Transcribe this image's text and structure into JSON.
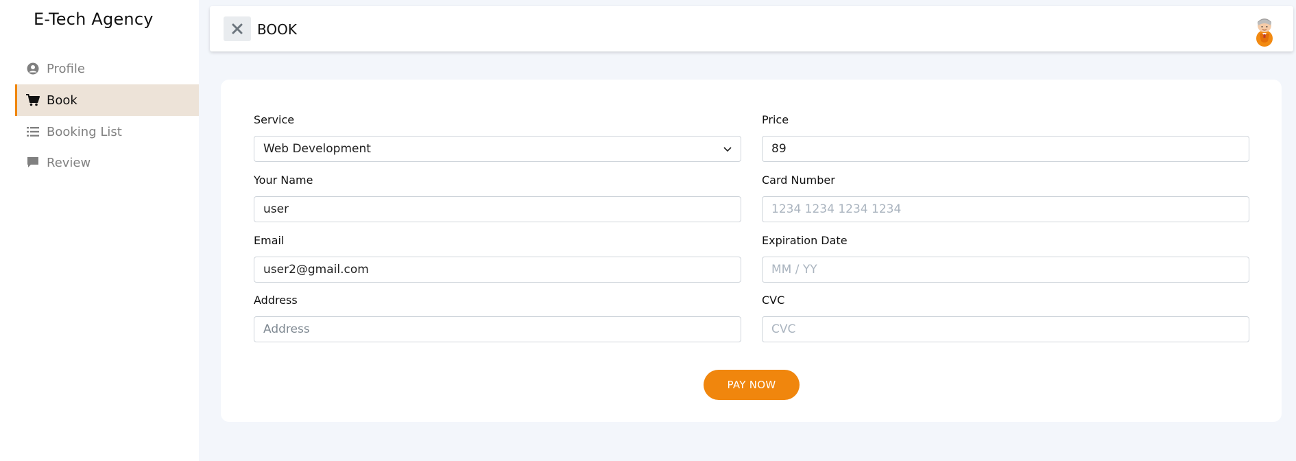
{
  "brand": "E-Tech Agency",
  "sidebar": {
    "items": [
      {
        "label": "Profile",
        "icon": "user-circle-icon"
      },
      {
        "label": "Book",
        "icon": "cart-icon",
        "active": true
      },
      {
        "label": "Booking List",
        "icon": "list-icon"
      },
      {
        "label": "Review",
        "icon": "comment-icon"
      }
    ]
  },
  "header": {
    "title": "BOOK"
  },
  "form": {
    "service": {
      "label": "Service",
      "value": "Web Development"
    },
    "price": {
      "label": "Price",
      "value": "89"
    },
    "name": {
      "label": "Your Name",
      "value": "user"
    },
    "card_number": {
      "label": "Card Number",
      "placeholder": "1234 1234 1234 1234"
    },
    "email": {
      "label": "Email",
      "value": "user2@gmail.com"
    },
    "expiration": {
      "label": "Expiration Date",
      "placeholder": "MM / YY"
    },
    "address": {
      "label": "Address",
      "placeholder": "Address"
    },
    "cvc": {
      "label": "CVC",
      "placeholder": "CVC"
    },
    "submit_label": "PAY NOW"
  },
  "colors": {
    "accent": "#f0860d",
    "active_bg": "#ede3d8",
    "page_bg": "#f3f6fb"
  }
}
